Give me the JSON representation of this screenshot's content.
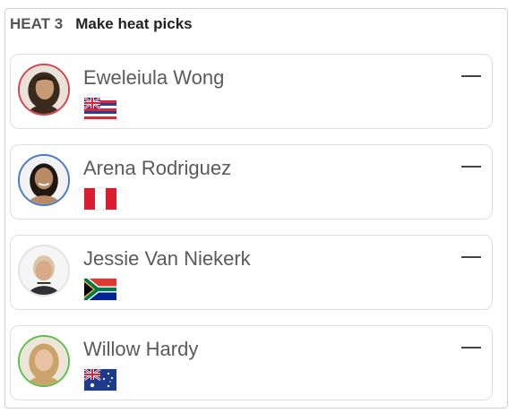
{
  "header": {
    "heat_label": "HEAT 3",
    "cta_label": "Make heat picks"
  },
  "surfers": [
    {
      "name": "Eweleiula Wong",
      "country_flag": "hawaii-flag-icon",
      "ring_color": "#d9434c",
      "pick_value": "—"
    },
    {
      "name": "Arena Rodriguez",
      "country_flag": "peru-flag-icon",
      "ring_color": "#4a78c8",
      "pick_value": "—"
    },
    {
      "name": "Jessie Van Niekerk",
      "country_flag": "south-africa-flag-icon",
      "ring_color": "#e3e3e3",
      "pick_value": "—"
    },
    {
      "name": "Willow Hardy",
      "country_flag": "australia-flag-icon",
      "ring_color": "#5cc04a",
      "pick_value": "—"
    }
  ]
}
